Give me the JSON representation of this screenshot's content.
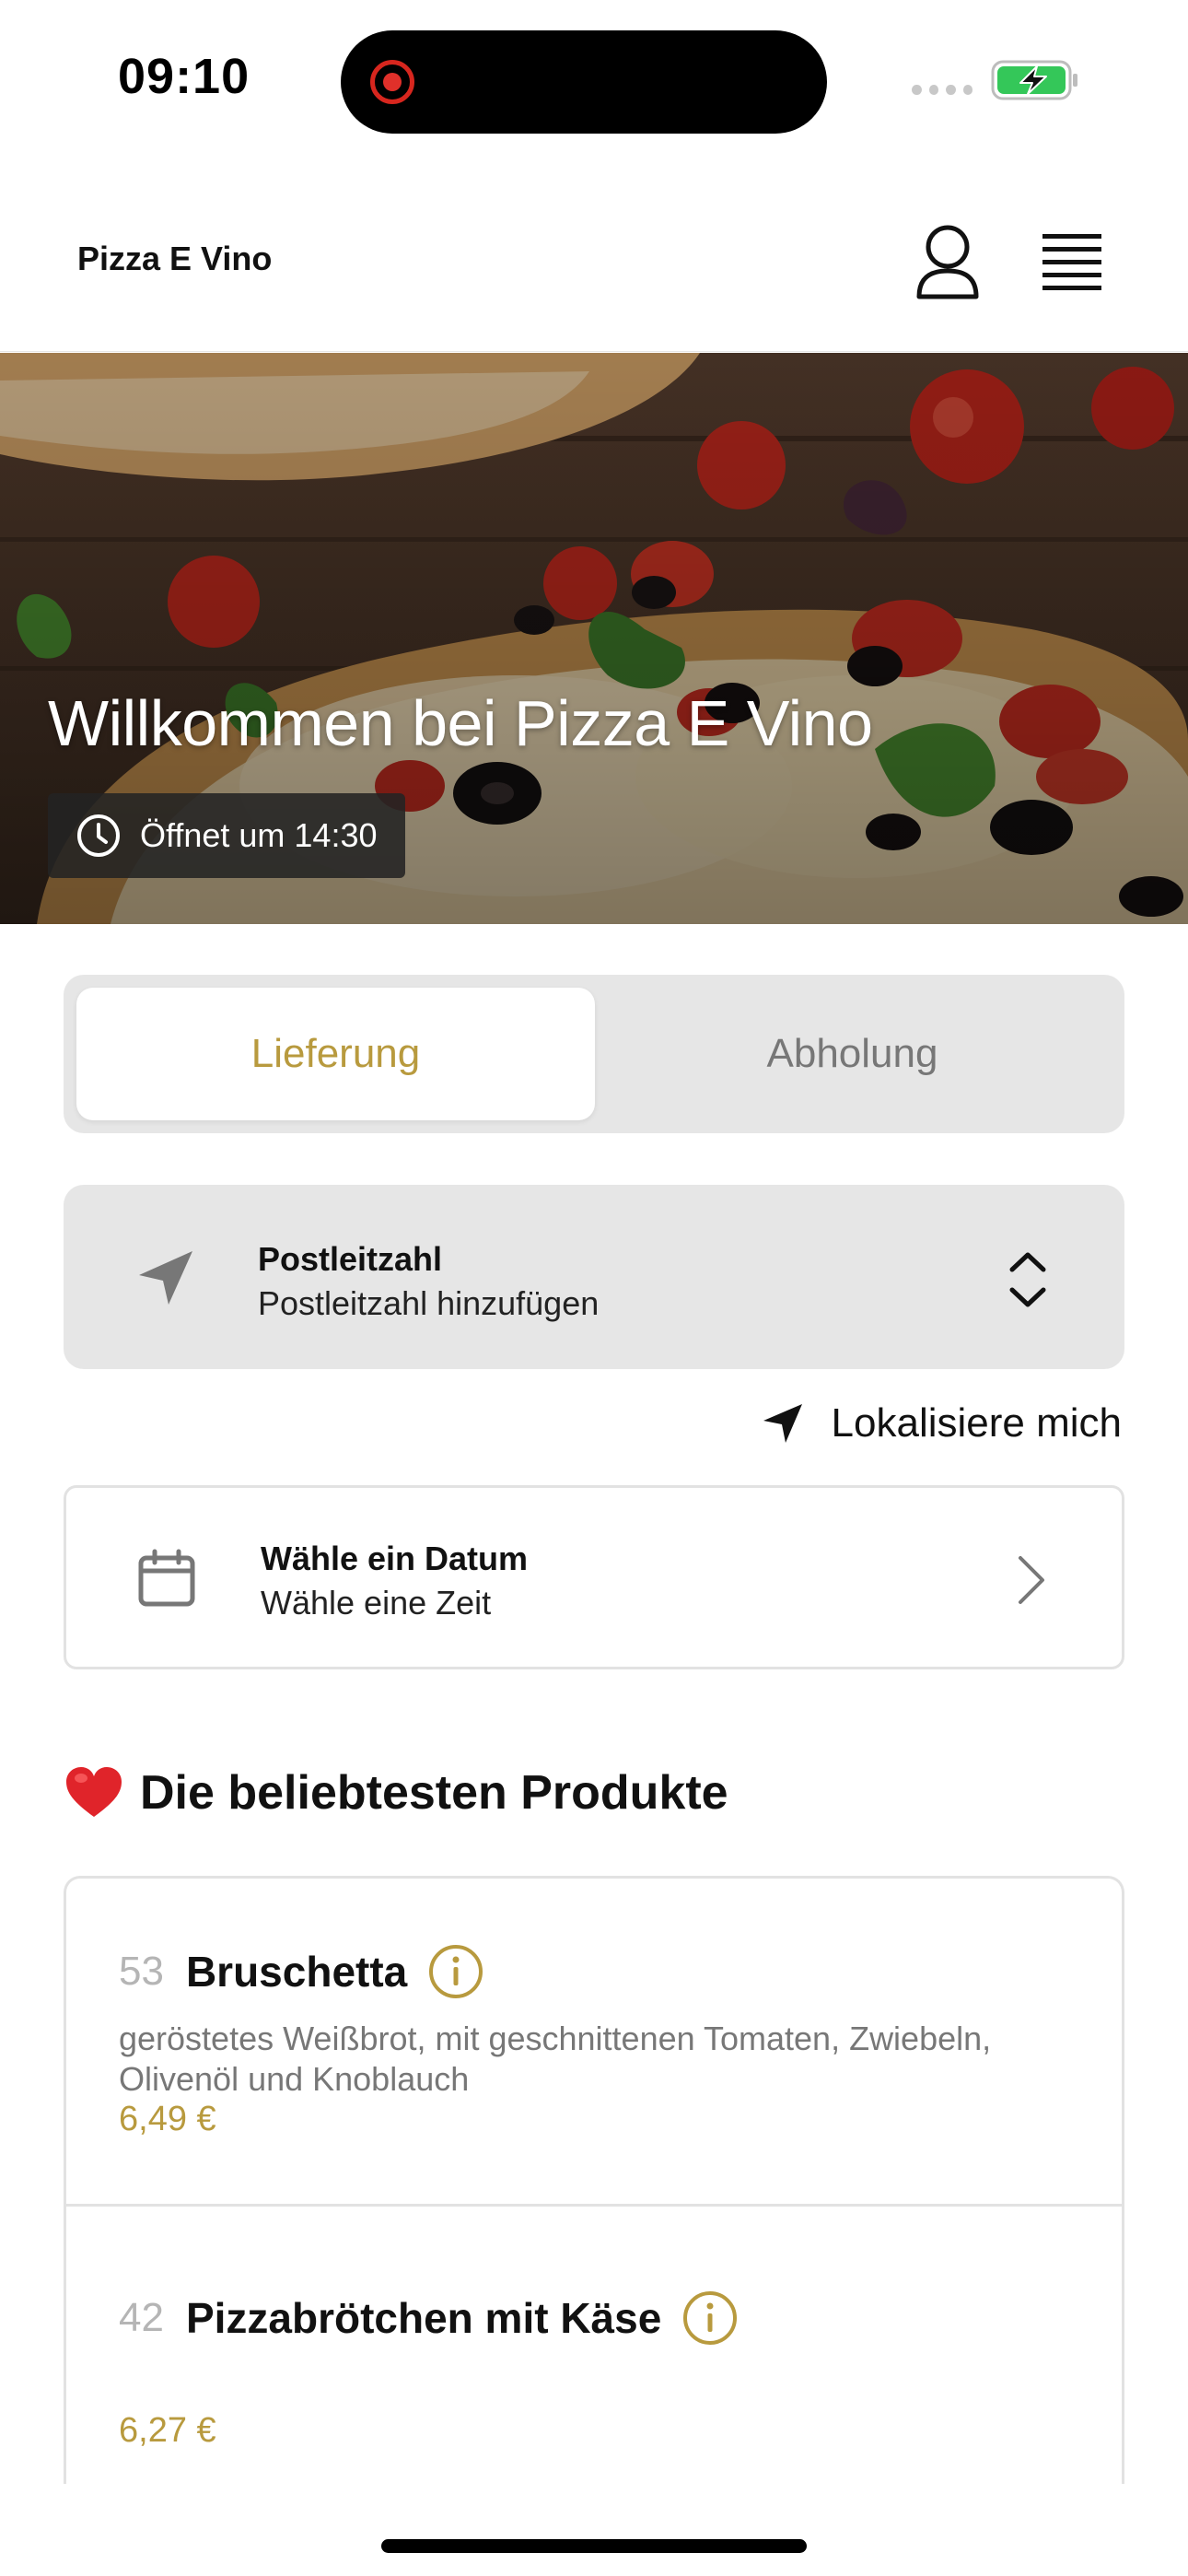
{
  "status_bar": {
    "time": "09:10",
    "icons": [
      "recording-indicator-icon",
      "cellular-signal-icon",
      "battery-charging-icon"
    ],
    "battery_color": "#34c759"
  },
  "header": {
    "brand": "Pizza E Vino",
    "icons": [
      "user-icon",
      "hamburger-menu-icon"
    ]
  },
  "hero": {
    "title": "Willkommen bei Pizza E Vino",
    "opening_label": "Öffnet um 14:30",
    "opening_icon": "clock-icon"
  },
  "order_mode": {
    "tabs": [
      {
        "label": "Lieferung",
        "selected": true
      },
      {
        "label": "Abholung",
        "selected": false
      }
    ],
    "accent_color": "#b89a3e"
  },
  "zip": {
    "title": "Postleitzahl",
    "subtitle": "Postleitzahl hinzufügen",
    "icon": "location-arrow-icon"
  },
  "locate": {
    "label": "Lokalisiere mich",
    "icon": "navigation-arrow-icon"
  },
  "date": {
    "title": "Wähle ein Datum",
    "subtitle": "Wähle eine Zeit",
    "icon": "calendar-icon"
  },
  "popular": {
    "title": "Die beliebtesten Produkte",
    "emoji": "❤️",
    "products": [
      {
        "number": "53",
        "name": "Bruschetta",
        "description": "geröstetes Weißbrot, mit geschnittenen Tomaten, Zwiebeln, Olivenöl und Knoblauch",
        "price": "6,49 €"
      },
      {
        "number": "42",
        "name": "Pizzabrötchen mit Käse",
        "description": "",
        "price": "6,27 €"
      }
    ]
  }
}
